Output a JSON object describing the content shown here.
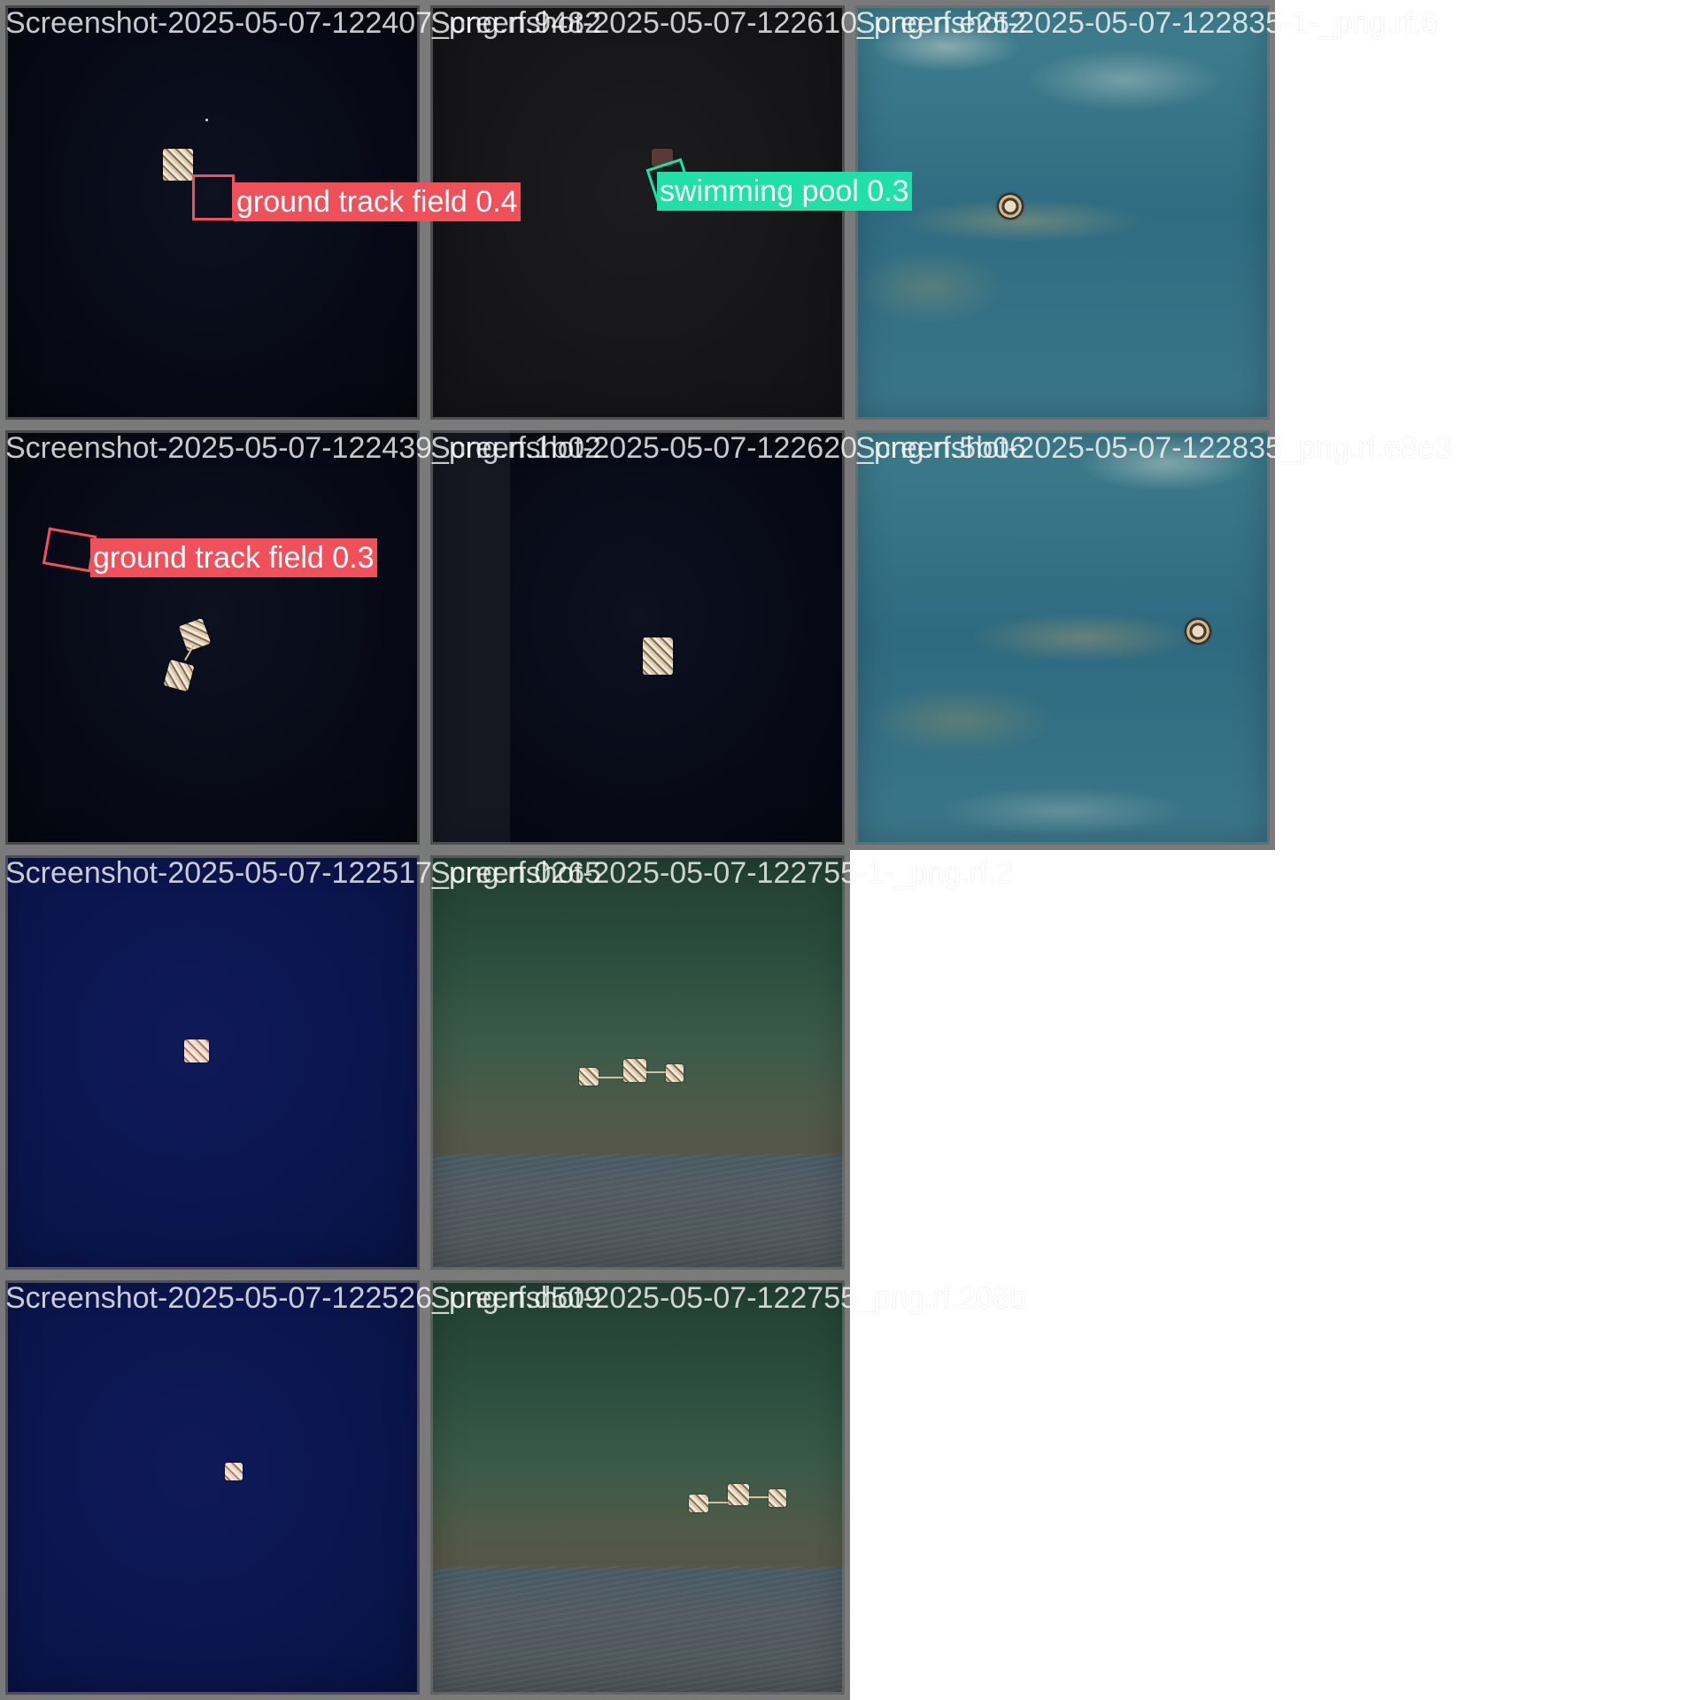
{
  "tiles": [
    {
      "caption": "Screenshot-2025-05-07-122407_png.rf.9482"
    },
    {
      "caption": "Screenshot-2025-05-07-122610_png.rf.e252"
    },
    {
      "caption": "Screenshot-2025-05-07-122835-1-_png.rf.6"
    },
    {
      "caption": "Screenshot-2025-05-07-122439_png.rf.1b02"
    },
    {
      "caption": "Screenshot-2025-05-07-122620_png.rf.5b06"
    },
    {
      "caption": "Screenshot-2025-05-07-122835_png.rf.e8e3"
    },
    {
      "caption": "Screenshot-2025-05-07-122517_png.rf.0265"
    },
    {
      "caption": "Screenshot-2025-05-07-122755-1-_png.rf.2"
    },
    {
      "caption": "Screenshot-2025-05-07-122526_png.rf.d509"
    },
    {
      "caption": "Screenshot-2025-05-07-122755_png.rf.208b"
    }
  ],
  "detections": [
    {
      "label": "ground track field 0.4",
      "color": "#f0505a"
    },
    {
      "label": "swimming pool 0.3",
      "color": "#20e0a8"
    },
    {
      "label": "ground track field 0.3",
      "color": "#f0505a"
    }
  ]
}
